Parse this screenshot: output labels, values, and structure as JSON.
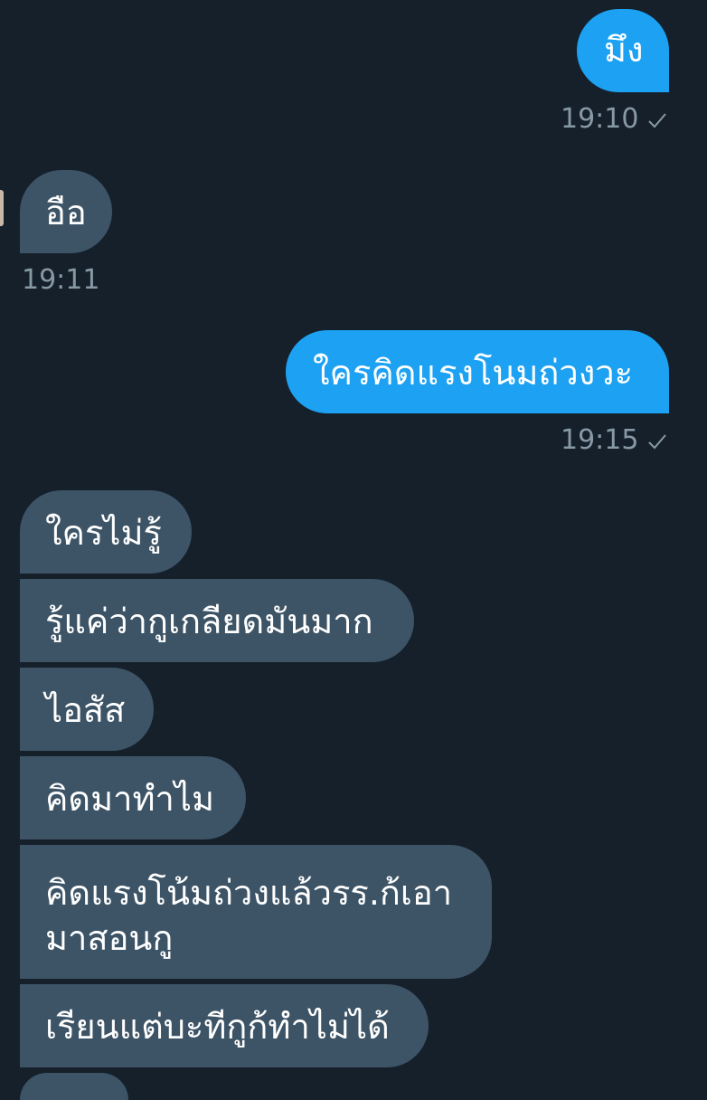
{
  "conversation": {
    "messages": [
      {
        "direction": "out",
        "text": "มึง",
        "time": "19:10",
        "status_icon": "check-icon"
      },
      {
        "direction": "in",
        "text": "อือ",
        "time": "19:11"
      },
      {
        "direction": "out",
        "text": "ใครคิดแรงโนมถ่วงวะ",
        "time": "19:15",
        "status_icon": "check-icon"
      },
      {
        "direction": "in",
        "text": "ใครไม่รู้"
      },
      {
        "direction": "in",
        "text": "รู้แค่ว่ากูเกลียดมันมาก"
      },
      {
        "direction": "in",
        "text": "ไอสัส"
      },
      {
        "direction": "in",
        "text": "คิดมาทำไม"
      },
      {
        "direction": "in",
        "lines": [
          "คิดแรงโน้มถ่วงแล้วรร.ก้เอา",
          "มาสอนกู"
        ]
      },
      {
        "direction": "in",
        "text": "เรียนแต่บะทีกูก้ทำไม่ได้"
      }
    ]
  },
  "colors": {
    "background": "#15202b",
    "outgoing_bubble": "#1da1f2",
    "incoming_bubble": "#3d5466",
    "meta_text": "#8899a6"
  }
}
